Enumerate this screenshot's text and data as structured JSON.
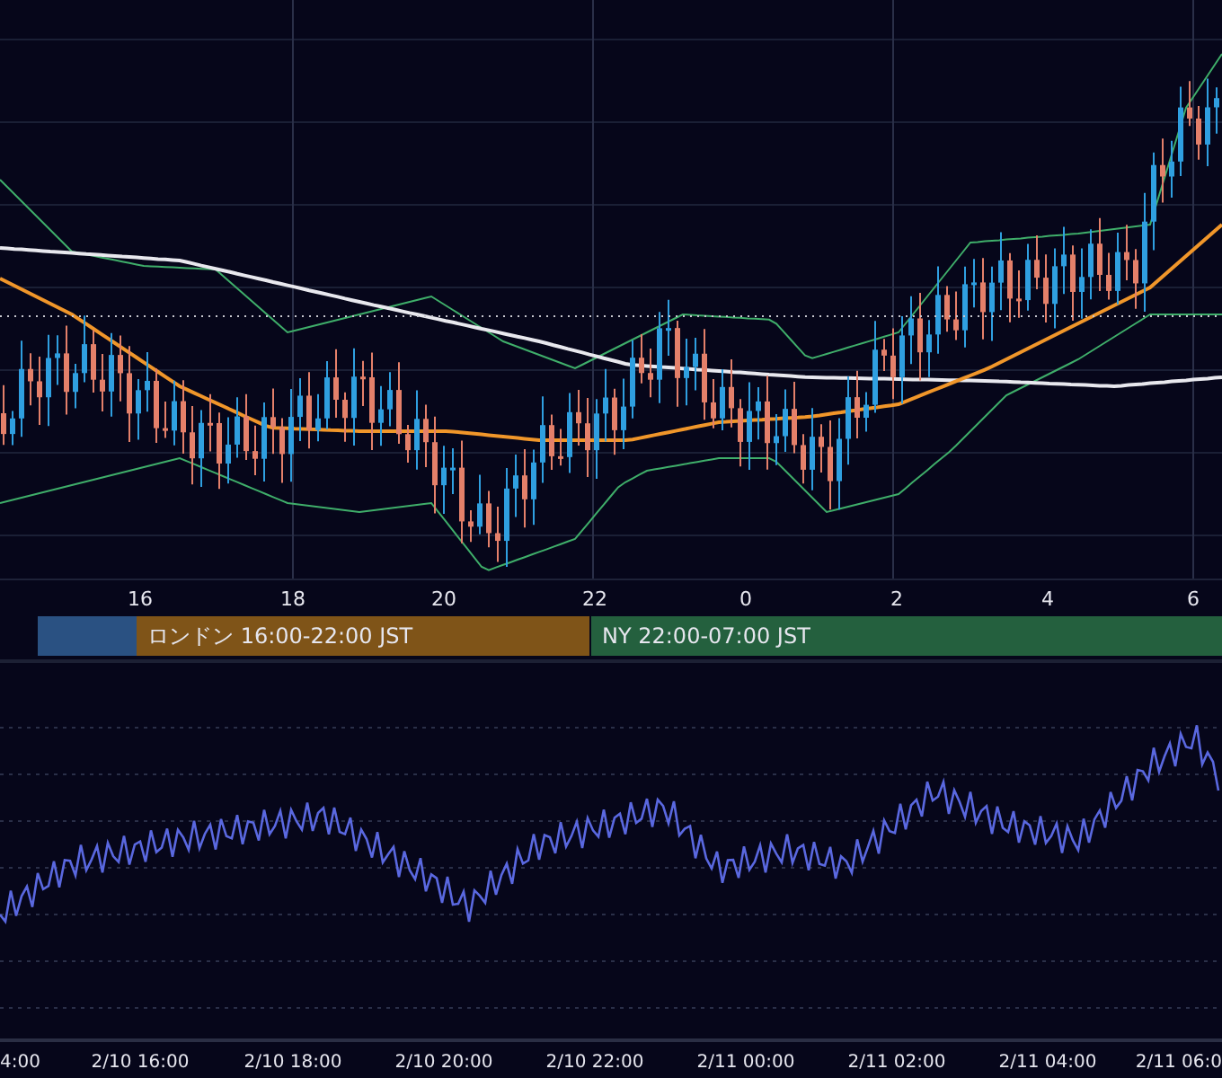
{
  "hour_axis": {
    "labels": [
      "16",
      "18",
      "20",
      "22",
      "0",
      "2",
      "4",
      "6"
    ]
  },
  "sessions": [
    {
      "color": "#2a5182"
    },
    {
      "label": "ロンドン 16:00-22:00 JST",
      "color": "#7f5418"
    },
    {
      "label": "NY 22:00-07:00 JST",
      "color": "#24603e"
    }
  ],
  "time_axis": {
    "labels": [
      "4:00",
      "2/10 16:00",
      "2/10 18:00",
      "2/10 20:00",
      "2/10 22:00",
      "2/11 00:00",
      "2/11 02:00",
      "2/11 04:00",
      "2/11 06:0"
    ]
  }
}
